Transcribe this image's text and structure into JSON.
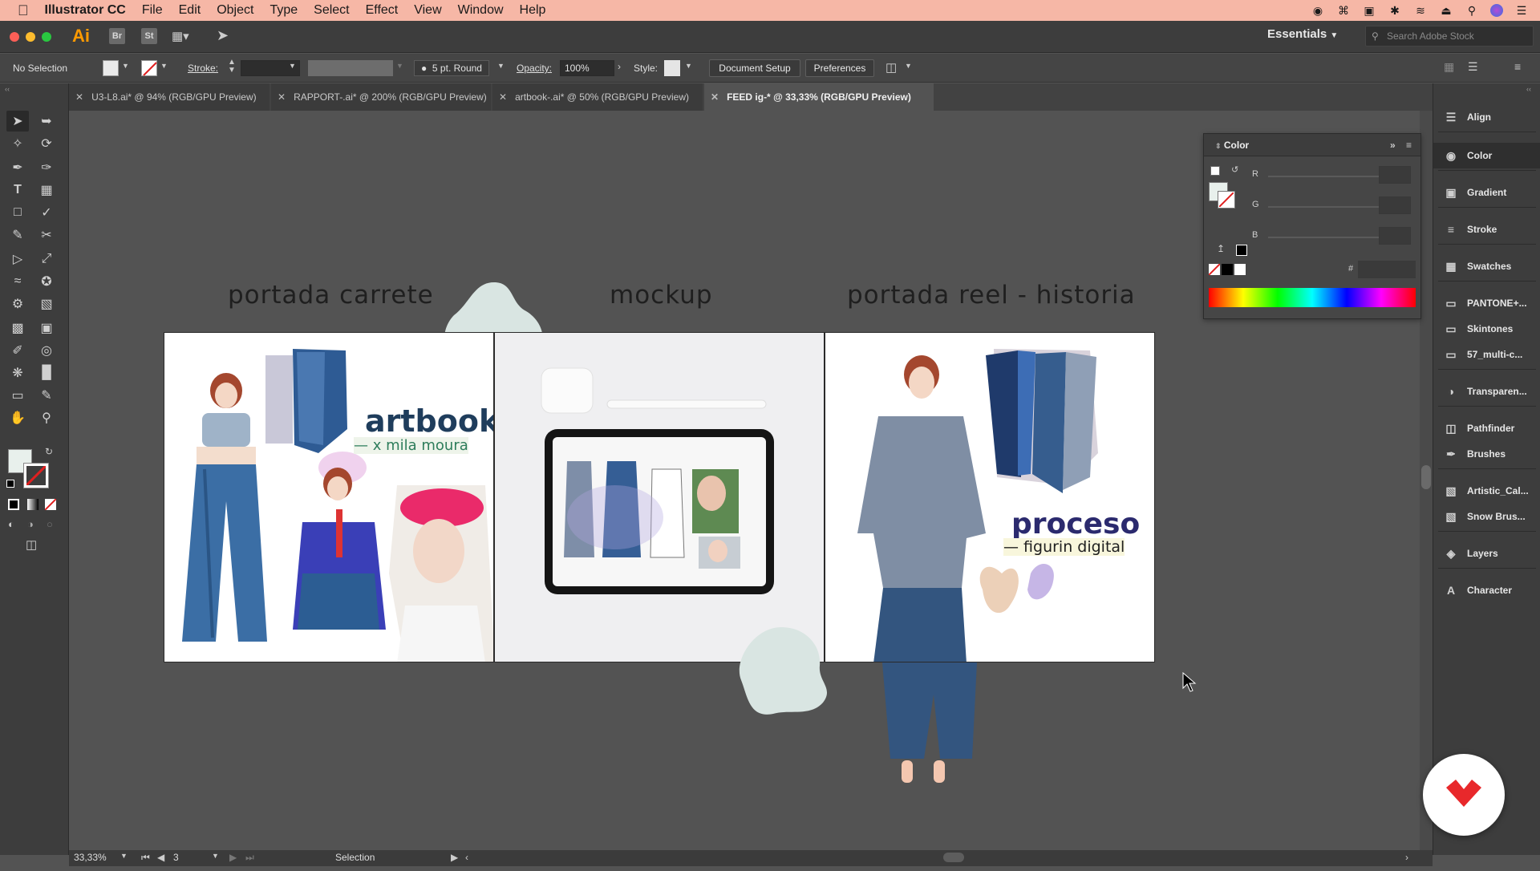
{
  "menubar": {
    "app_name": "Illustrator CC",
    "menus": [
      "File",
      "Edit",
      "Object",
      "Type",
      "Select",
      "Effect",
      "View",
      "Window",
      "Help"
    ]
  },
  "appbar": {
    "app_logo": "Ai",
    "bridge": "Br",
    "stock": "St",
    "workspace": "Essentials",
    "search_placeholder": "Search Adobe Stock"
  },
  "controlbar": {
    "selection_status": "No Selection",
    "stroke_label": "Stroke:",
    "brush_label": "5 pt. Round",
    "opacity_label": "Opacity:",
    "opacity_value": "100%",
    "style_label": "Style:",
    "document_setup": "Document Setup",
    "preferences": "Preferences"
  },
  "tabs": [
    {
      "label": "U3-L8.ai* @ 94% (RGB/GPU Preview)"
    },
    {
      "label": "RAPPORT-.ai* @ 200% (RGB/GPU Preview)"
    },
    {
      "label": "artbook-.ai* @ 50% (RGB/GPU Preview)"
    },
    {
      "label": "FEED ig-* @ 33,33% (RGB/GPU Preview)"
    }
  ],
  "canvas": {
    "headings": [
      "portada carrete",
      "mockup",
      "portada reel - historia"
    ],
    "artboard1": {
      "title": "artbook",
      "subtitle": "— x mila moura"
    },
    "artboard3": {
      "title": "proceso",
      "subtitle": "— figurin digital"
    }
  },
  "color_panel": {
    "title": "Color",
    "channels": [
      "R",
      "G",
      "B"
    ],
    "hex_label": "#"
  },
  "panels": [
    {
      "label": "Align",
      "icon": "align-icon"
    },
    {
      "label": "Color",
      "icon": "color-icon"
    },
    {
      "label": "Gradient",
      "icon": "gradient-icon"
    },
    {
      "label": "Stroke",
      "icon": "stroke-icon"
    },
    {
      "label": "Swatches",
      "icon": "swatches-icon"
    },
    {
      "label": "PANTONE+...",
      "icon": "folder-icon"
    },
    {
      "label": "Skintones",
      "icon": "folder-icon"
    },
    {
      "label": "57_multi-c...",
      "icon": "folder-icon"
    },
    {
      "label": "Transparen...",
      "icon": "transparency-icon"
    },
    {
      "label": "Pathfinder",
      "icon": "pathfinder-icon"
    },
    {
      "label": "Brushes",
      "icon": "brushes-icon"
    },
    {
      "label": "Artistic_Cal...",
      "icon": "brush-library-icon"
    },
    {
      "label": "Snow Brus...",
      "icon": "brush-library-icon"
    },
    {
      "label": "Layers",
      "icon": "layers-icon"
    },
    {
      "label": "Character",
      "icon": "character-icon"
    }
  ],
  "statusbar": {
    "zoom": "33,33%",
    "artboard_number": "3",
    "tool": "Selection"
  },
  "colors": {
    "menubar_bg": "#f6b7a6",
    "accent_title": "#1f3d5c",
    "accent_subtitle": "#2e7d5b"
  }
}
